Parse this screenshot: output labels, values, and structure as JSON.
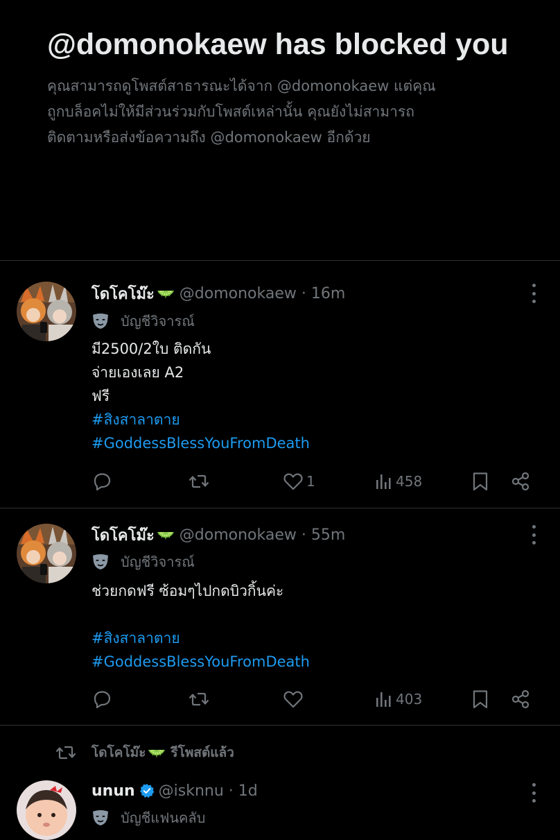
{
  "blocked": {
    "title": "@domonokaew has blocked you",
    "desc_line1": "คุณสามารถดูโพสต์สาธารณะได้จาก @domonokaew แต่คุณ",
    "desc_line2": "ถูกบล็อคไม่ให้มีส่วนร่วมกับโพสต์เหล่านั้น คุณยังไม่สามารถ",
    "desc_line3": "ติดตามหรือส่งข้อความถึง @domonokaew อีกด้วย"
  },
  "tweets": [
    {
      "display_name": "โดโคโม๊ะ",
      "name_emoji": "lime-icon",
      "handle_time": "@domonokaew · 16m",
      "label": "บัญชีวิจารณ์",
      "lines": [
        "มี2500/2ใบ ติดกัน",
        "จ่ายเองเลย A2",
        "ฟรี"
      ],
      "hashtags": [
        "#สิงสาลาตาย",
        "#GoddessBlessYouFromDeath"
      ],
      "likes": "1",
      "views": "458"
    },
    {
      "display_name": "โดโคโม๊ะ",
      "name_emoji": "lime-icon",
      "handle_time": "@domonokaew · 55m",
      "label": "บัญชีวิจารณ์",
      "lines": [
        "ช่วยกดฟรี ซ้อมๆไปกดบิวกิ้นค่ะ",
        ""
      ],
      "hashtags": [
        "#สิงสาลาตาย",
        "#GoddessBlessYouFromDeath"
      ],
      "likes": "",
      "views": "403"
    }
  ],
  "retweet": {
    "retweeter": "โดโคโม๊ะ",
    "retweet_text": "รีโพสต์แล้ว",
    "display_name": "unun",
    "handle_time": "@isknnu · 1d",
    "label": "บัญชีแฟนคลับ"
  },
  "colors": {
    "background": "#000000",
    "text": "#e7e9ea",
    "muted": "#71767b",
    "link": "#1d9bf0",
    "divider": "#2f3336"
  }
}
